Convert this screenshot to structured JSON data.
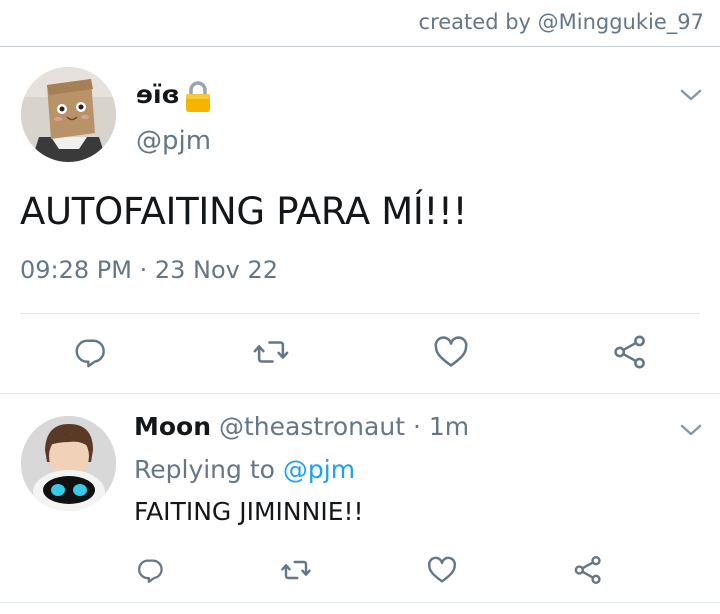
{
  "credit": "created by @Minggukie_97",
  "tweet": {
    "display_name": "ɘïɞ",
    "handle": "@pjm",
    "text": "AUTOFAITING PARA MÍ!!!",
    "time": "09:28 PM · 23 Nov 22",
    "locked": true
  },
  "reply": {
    "display_name": "Moon",
    "handle": "@theastronaut",
    "dot": " · ",
    "age": "1m",
    "replying_prefix": "Replying to ",
    "replying_handle": "@pjm",
    "text": "FAITING JIMINNIE!!"
  },
  "icons": [
    "chevron-down-icon",
    "lock-icon",
    "reply-icon",
    "retweet-icon",
    "like-icon",
    "share-icon"
  ],
  "colors": {
    "secondary_text": "#657786",
    "link": "#1da1f2",
    "divider": "#e1e8ed",
    "lock_gold": "#f4b400"
  }
}
